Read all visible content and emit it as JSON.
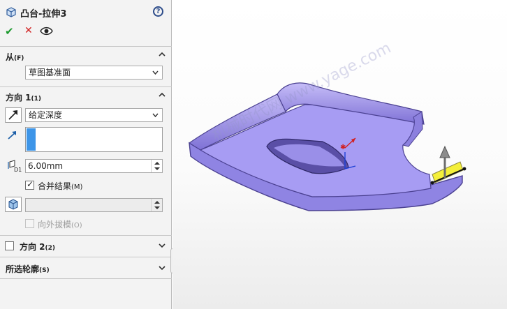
{
  "feature": {
    "title": "凸台-拉伸3"
  },
  "actions": {
    "ok": "✔",
    "cancel": "✕"
  },
  "from_section": {
    "title_main": "从",
    "title_small": "(F)",
    "selected": "草图基准面"
  },
  "direction1": {
    "title_main": "方向 1",
    "title_small": "(1)",
    "end_condition": "给定深度",
    "depth": "6.00mm",
    "merge_label": "合并结果",
    "merge_hotkey": "(M)",
    "merge_checked": true,
    "draft_label": "向外拔模",
    "draft_hotkey": "(O)"
  },
  "direction2": {
    "title_main": "方向 2",
    "title_small": "(2)"
  },
  "contours": {
    "title_main": "所选轮廓",
    "title_small": "(S)"
  },
  "watermark": {
    "text": "机械时代网  www.yage.com"
  },
  "colors": {
    "part_fill": "#a79cf3",
    "part_edge": "#5a4fa6",
    "accent_blue": "#3d95e8",
    "ok_green": "#1c9a2e",
    "cancel_red": "#d11f1f"
  }
}
